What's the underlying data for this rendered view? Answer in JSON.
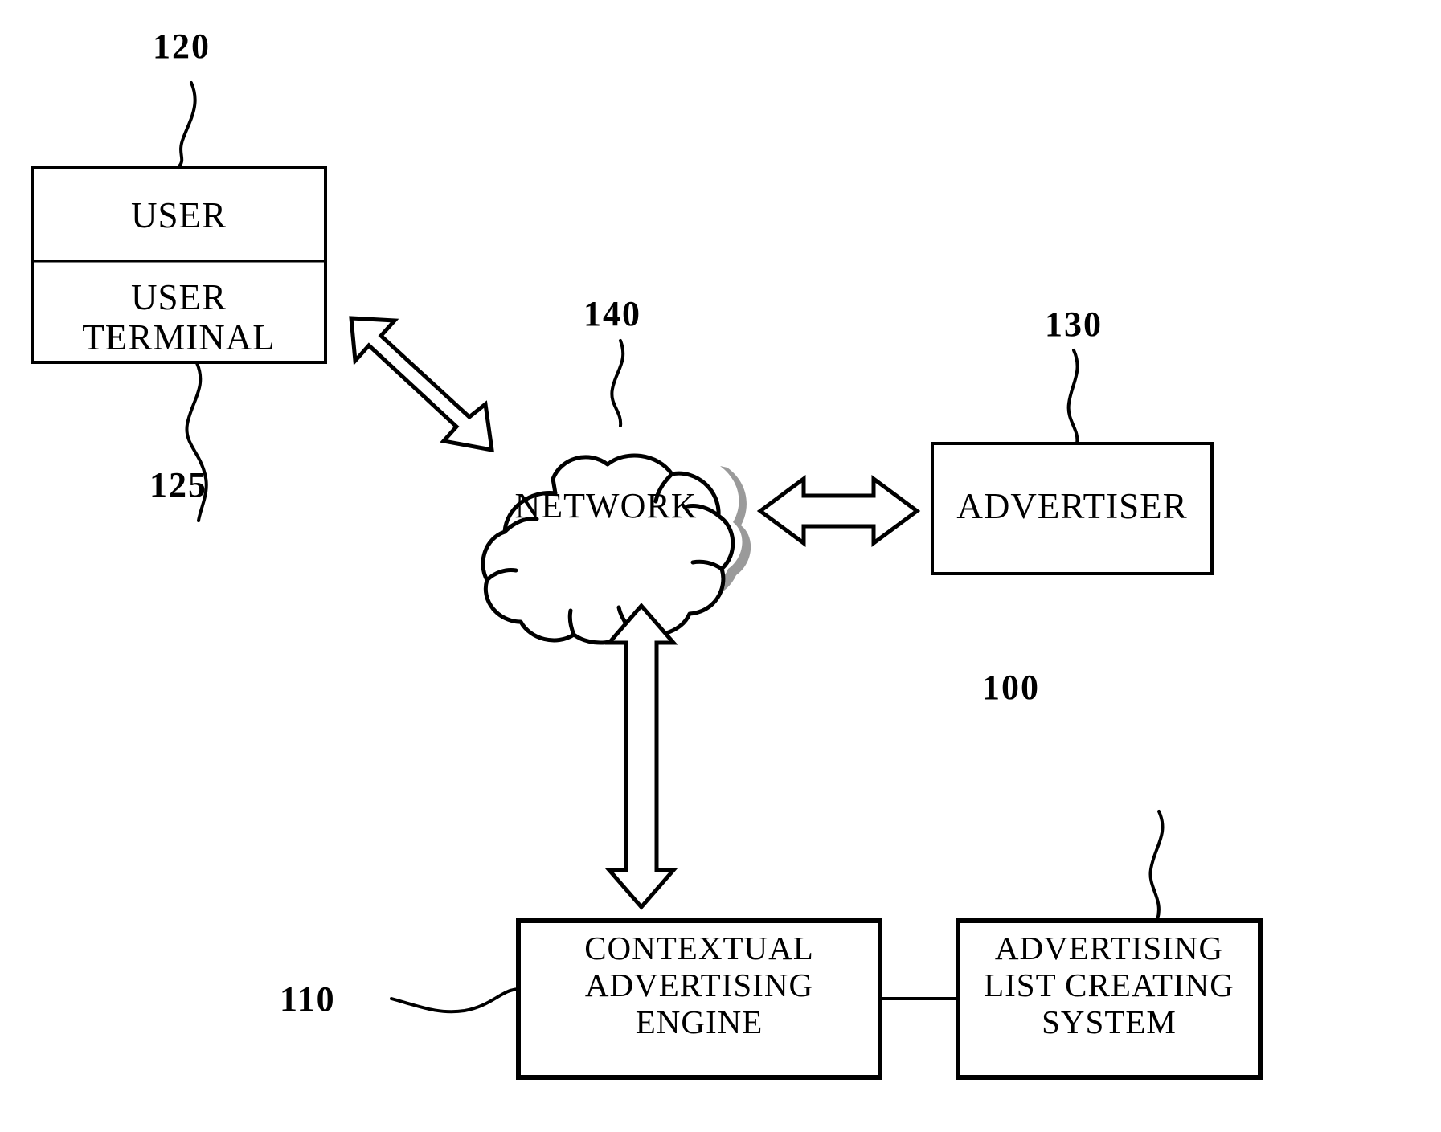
{
  "figure": {
    "type": "patent-system-block-diagram",
    "background_color": "#ffffff",
    "line_color": "#000000",
    "shadow_color": "#9a9a9a"
  },
  "reference_numerals": [
    {
      "id": "ref-120",
      "text": "120",
      "target": "user-box"
    },
    {
      "id": "ref-125",
      "text": "125",
      "target": "user-terminal-box"
    },
    {
      "id": "ref-140",
      "text": "140",
      "target": "network-cloud"
    },
    {
      "id": "ref-130",
      "text": "130",
      "target": "advertiser-box"
    },
    {
      "id": "ref-100",
      "text": "100",
      "target": "advertising-list-creating-system-box"
    },
    {
      "id": "ref-110",
      "text": "110",
      "target": "contextual-advertising-engine-box"
    }
  ],
  "blocks": {
    "user": {
      "label": "USER"
    },
    "user_terminal": {
      "label": "USER\nTERMINAL"
    },
    "network": {
      "label": "NETWORK"
    },
    "advertiser": {
      "label": "ADVERTISER"
    },
    "contextual_advertising_engine": {
      "label": "CONTEXTUAL\nADVERTISING\nENGINE"
    },
    "advertising_list_creating_system": {
      "label": "ADVERTISING\nLIST CREATING\nSYSTEM"
    }
  },
  "connectors": [
    {
      "id": "user-terminal-to-network",
      "style": "double-headed-arrow",
      "orientation": "diagonal"
    },
    {
      "id": "network-to-advertiser",
      "style": "double-headed-arrow",
      "orientation": "horizontal"
    },
    {
      "id": "network-to-engine",
      "style": "double-headed-arrow",
      "orientation": "vertical"
    },
    {
      "id": "engine-to-list-system",
      "style": "plain-line",
      "orientation": "horizontal"
    }
  ]
}
